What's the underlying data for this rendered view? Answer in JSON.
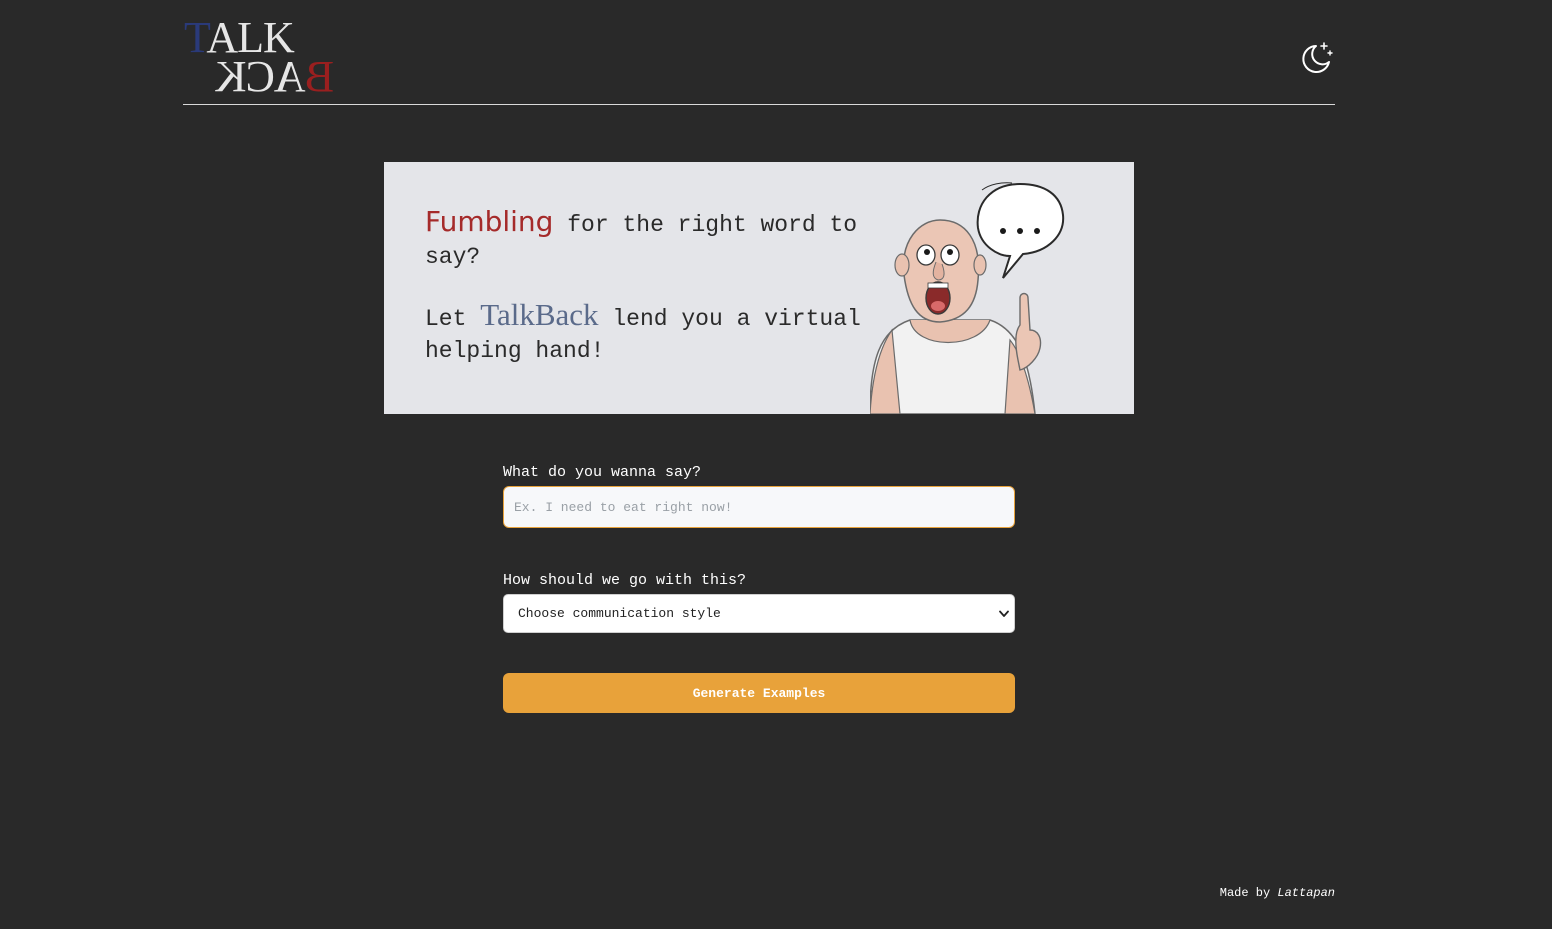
{
  "header": {
    "logo": {
      "top_text_first": "T",
      "top_text_rest": "ALK",
      "bottom_text_first": "B",
      "bottom_text_rest": "ACK",
      "colors": {
        "blue": "#2a3a7a",
        "red": "#9a1f1f",
        "light": "#e6e6e6"
      }
    },
    "theme_toggle_icon": "moon-stars-icon"
  },
  "hero": {
    "line1_highlight": "Fumbling",
    "line1_rest": " for the right word to say?",
    "line2_start": "Let ",
    "line2_brand": "TalkBack",
    "line2_rest": " lend you a virtual helping hand!",
    "speech_bubble_text": "...",
    "illustration": "man-pointing-up-with-speech-bubble"
  },
  "form": {
    "message_label": "What do you wanna say?",
    "message_placeholder": "Ex. I need to eat right now!",
    "message_value": "",
    "style_label": "How should we go with this?",
    "style_selected": "Choose communication style",
    "submit_label": "Generate Examples"
  },
  "footer": {
    "made_by": "Made by ",
    "author": "Lattapan"
  },
  "colors": {
    "background": "#292929",
    "accent": "#e8a23a",
    "hero_background": "#e4e5e9",
    "highlight_red": "#a52a2a"
  }
}
